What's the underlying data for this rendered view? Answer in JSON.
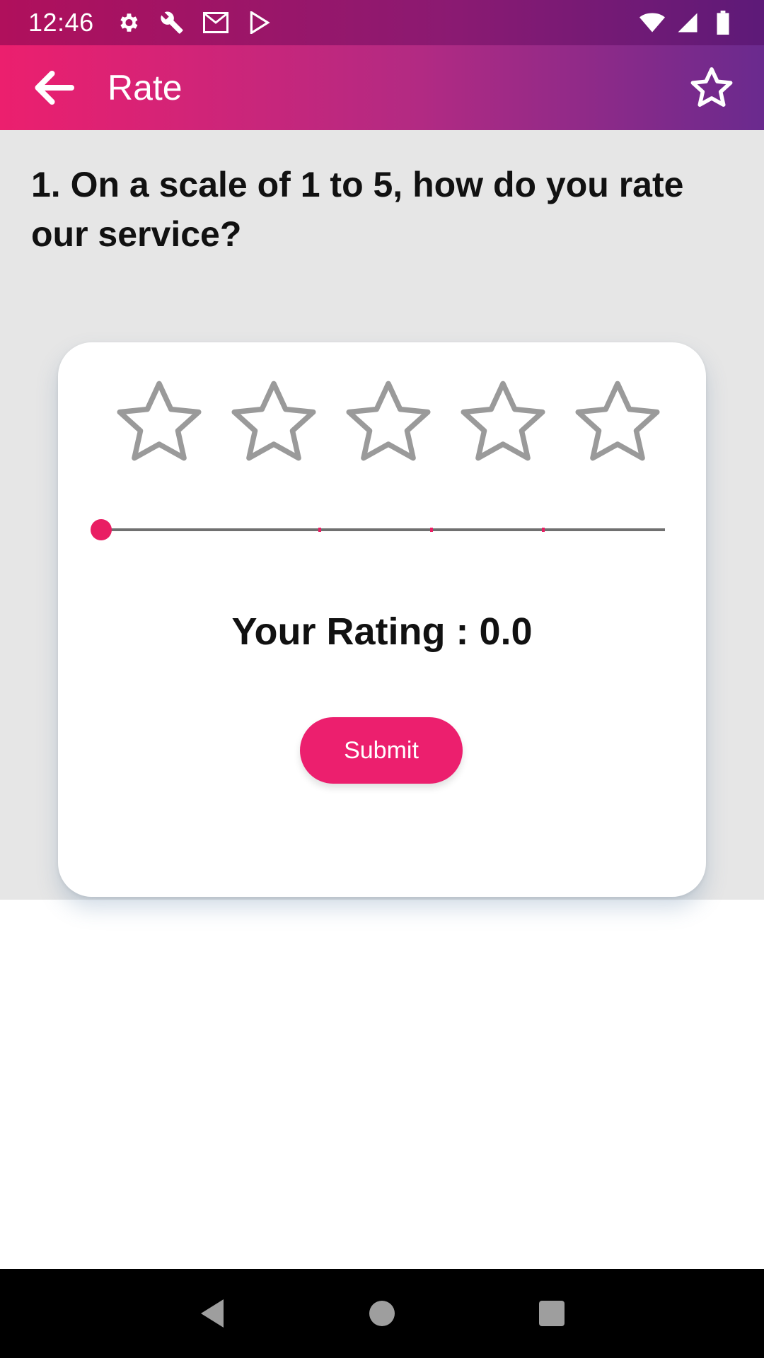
{
  "status_bar": {
    "time": "12:46",
    "icons_left": [
      "settings-gear-icon",
      "wrench-icon",
      "gmail-icon",
      "play-store-icon"
    ],
    "icons_right": [
      "wifi-icon",
      "signal-icon",
      "battery-icon"
    ]
  },
  "app_bar": {
    "title": "Rate",
    "back_icon": "arrow-back-icon",
    "action_icon": "star-outline-icon",
    "gradient": [
      "#ec1f6e",
      "#6a2a8e"
    ]
  },
  "question": {
    "text": "1. On a scale of 1 to 5, how do you rate our service?"
  },
  "rating_card": {
    "stars": [
      {
        "index": 1,
        "filled": false
      },
      {
        "index": 2,
        "filled": false
      },
      {
        "index": 3,
        "filled": false
      },
      {
        "index": 4,
        "filled": false
      },
      {
        "index": 5,
        "filled": false
      }
    ],
    "slider": {
      "min": 0,
      "max": 5,
      "value": 0.0,
      "accent": "#e91e63"
    },
    "rating_label": "Your Rating : 0.0",
    "submit_label": "Submit"
  },
  "nav_bar": {
    "buttons": [
      "back-triangle-icon",
      "home-circle-icon",
      "recents-square-icon"
    ]
  }
}
